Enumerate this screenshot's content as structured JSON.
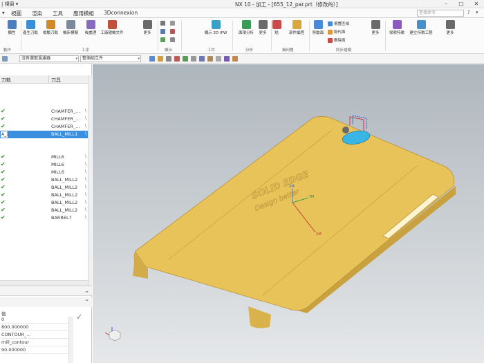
{
  "title_bar": {
    "left_text": "| 視窗 ▾",
    "center_text": "NX 10 - 加工 - [655_12_par.prt（修改的）]"
  },
  "menu": {
    "items": [
      "▾",
      "視圖",
      "渲染",
      "工具",
      "應用模組",
      "3Dconnexion"
    ],
    "search_placeholder": "查找命令"
  },
  "ribbon": {
    "buttons": [
      {
        "label": "顯性",
        "color": "#4a7fc0"
      },
      {
        "label": "產生刀軌",
        "color": "#3a8fd8"
      },
      {
        "label": "檢驗刀軌",
        "color": "#d08a2a"
      },
      {
        "label": "機床模擬",
        "color": "#7a8a9a"
      },
      {
        "label": "後處理",
        "color": "#8a6ac0"
      },
      {
        "label": "工廠隨機文件",
        "color": "#c0503a"
      },
      {
        "label": "更多",
        "color": "#6a6a6a"
      },
      {
        "label": "顯示 3D IPW",
        "color": "#3aa0c8"
      },
      {
        "label": "面積分析",
        "color": "#3a9a5a"
      },
      {
        "label": "更多",
        "color": "#6a6a6a"
      },
      {
        "label": "點",
        "color": "#c84a4a"
      },
      {
        "label": "部件編程",
        "color": "#d8a83a"
      },
      {
        "label": "移動面",
        "color": "#4a8ad8"
      },
      {
        "label": "更多",
        "color": "#6a6a6a"
      },
      {
        "label": "探索特徵",
        "color": "#8a5ac0"
      },
      {
        "label": "建立特徵工藝",
        "color": "#4a90c8"
      },
      {
        "label": "更多",
        "color": "#6a6a6a"
      }
    ],
    "small_items": [
      "偏置區域",
      "取代面",
      "刪除面"
    ],
    "groups": [
      "動作",
      "工序",
      "顯示",
      "工件",
      "分析",
      "幾何體",
      "同步建模"
    ]
  },
  "filter_bar": {
    "combo1": "沒有選取過濾器",
    "combo2": "整個組立件"
  },
  "navigator": {
    "columns": [
      "刀軌",
      "刀具"
    ],
    "rows": [
      {
        "check": "",
        "tool": "",
        "bs": ""
      },
      {
        "check": "",
        "tool": "",
        "bs": ""
      },
      {
        "check": "",
        "tool": "",
        "bs": ""
      },
      {
        "check": "✔",
        "tool": "CHAMFER_...",
        "bs": "\\"
      },
      {
        "check": "✔",
        "tool": "CHAMFER_...",
        "bs": "\\"
      },
      {
        "check": "✔",
        "tool": "CHAMFER_...",
        "bs": "\\"
      },
      {
        "check": "A_1",
        "tool": "BALL_MILL1",
        "bs": "\\",
        "selected": true
      },
      {
        "check": "",
        "tool": "",
        "bs": ""
      },
      {
        "check": "",
        "tool": "",
        "bs": ""
      },
      {
        "check": "✔",
        "tool": "MILL6",
        "bs": "\\"
      },
      {
        "check": "✔",
        "tool": "MILL6",
        "bs": "\\"
      },
      {
        "check": "✔",
        "tool": "MILL6",
        "bs": "\\"
      },
      {
        "check": "✔",
        "tool": "BALL_MILL2",
        "bs": "\\"
      },
      {
        "check": "✔",
        "tool": "BALL_MILL2",
        "bs": "\\"
      },
      {
        "check": "✔",
        "tool": "BALL_MILL2",
        "bs": "\\"
      },
      {
        "check": "✔",
        "tool": "BALL_MILL2",
        "bs": "\\"
      },
      {
        "check": "✔",
        "tool": "BALL_MILL2",
        "bs": "\\"
      },
      {
        "check": "✔",
        "tool": "BARREL7",
        "bs": "\\"
      }
    ]
  },
  "details": {
    "column": "值",
    "values": [
      "0",
      "800.000000",
      "CONTOUR_...",
      "mill_contour",
      "90.000000"
    ]
  },
  "viewport": {
    "brand_line1": "SOLID EDGE",
    "brand_line2": "Design better",
    "axis_z": "ZM",
    "axis_y": "YM",
    "axis_x": "XM",
    "part_color": "#e8c35a",
    "hole_color": "#39b6e6"
  }
}
